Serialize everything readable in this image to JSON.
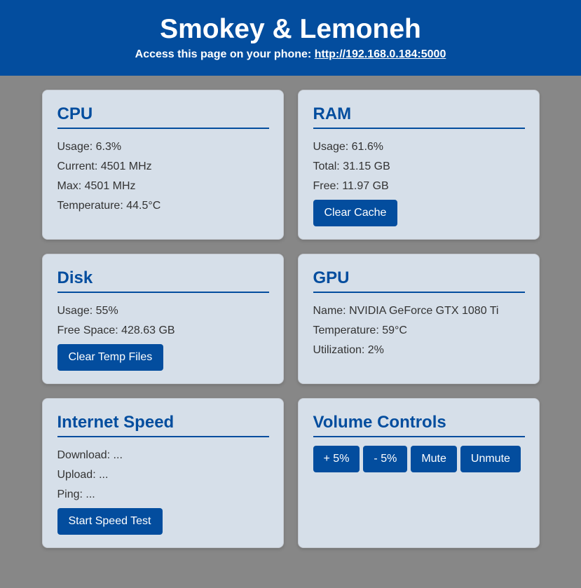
{
  "header": {
    "title": "Smokey & Lemoneh",
    "access_text": "Access this page on your phone: ",
    "access_link": "http://192.168.0.184:5000"
  },
  "cpu": {
    "title": "CPU",
    "usage": "Usage: 6.3%",
    "current": "Current: 4501 MHz",
    "max": "Max: 4501 MHz",
    "temperature": "Temperature: 44.5°C"
  },
  "ram": {
    "title": "RAM",
    "usage": "Usage: 61.6%",
    "total": "Total: 31.15 GB",
    "free": "Free: 11.97 GB",
    "clear_cache_label": "Clear Cache"
  },
  "disk": {
    "title": "Disk",
    "usage": "Usage: 55%",
    "free_space": "Free Space: 428.63 GB",
    "clear_temp_label": "Clear Temp Files"
  },
  "gpu": {
    "title": "GPU",
    "name": "Name: NVIDIA GeForce GTX 1080 Ti",
    "temperature": "Temperature: 59°C",
    "utilization": "Utilization: 2%"
  },
  "internet": {
    "title": "Internet Speed",
    "download": "Download: ...",
    "upload": "Upload: ...",
    "ping": "Ping: ...",
    "start_label": "Start Speed Test"
  },
  "volume": {
    "title": "Volume Controls",
    "up_label": "+ 5%",
    "down_label": "- 5%",
    "mute_label": "Mute",
    "unmute_label": "Unmute"
  },
  "colors": {
    "accent": "#034d9e",
    "background": "#878787",
    "card": "#d6dfe9"
  }
}
